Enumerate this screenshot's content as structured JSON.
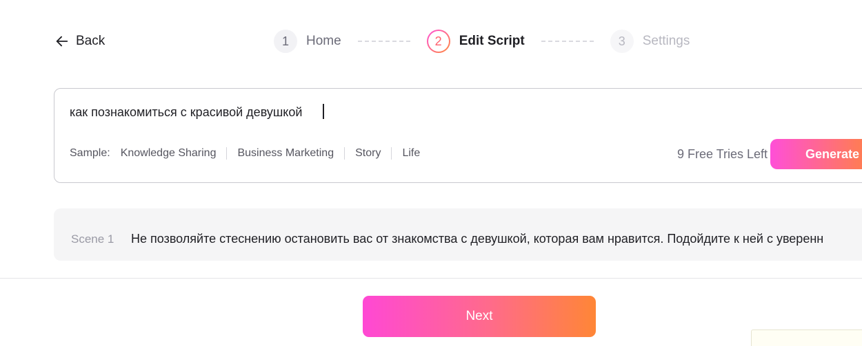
{
  "header": {
    "back_label": "Back",
    "steps": [
      {
        "num": "1",
        "label": "Home",
        "state": "done"
      },
      {
        "num": "2",
        "label": "Edit Script",
        "state": "active"
      },
      {
        "num": "3",
        "label": "Settings",
        "state": "todo"
      }
    ]
  },
  "prompt": {
    "value": "как познакомиться с красивой девушкой",
    "sample_label": "Sample:",
    "samples": [
      "Knowledge Sharing",
      "Business Marketing",
      "Story",
      "Life"
    ],
    "tries_left": "9 Free Tries Left",
    "generate_label": "Generate"
  },
  "scenes": [
    {
      "label": "Scene 1",
      "text": "Не позволяйте стеснению остановить вас от знакомства с девушкой, которая вам нравится. Подойдите к ней с уверенн"
    }
  ],
  "footer": {
    "next_label": "Next"
  },
  "colors": {
    "accent_start": "#ff4fd8",
    "accent_end": "#ff8a3c"
  }
}
